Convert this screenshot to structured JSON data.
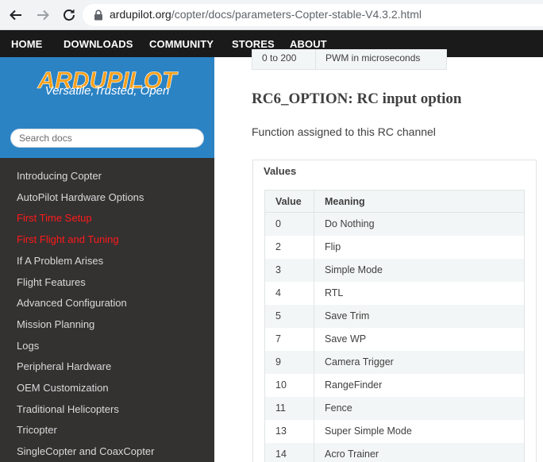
{
  "browser": {
    "url_host": "ardupilot.org",
    "url_path": "/copter/docs/parameters-Copter-stable-V4.3.2.html"
  },
  "topnav": [
    "HOME",
    "DOWNLOADS",
    "COMMUNITY",
    "STORES",
    "ABOUT"
  ],
  "brand": {
    "logo_text": "ARDUPILOT",
    "tagline": "Versatile,Trusted, Open",
    "search_placeholder": "Search docs"
  },
  "sidebar": {
    "items": [
      {
        "label": "Introducing Copter",
        "active": false
      },
      {
        "label": "AutoPilot Hardware Options",
        "active": false
      },
      {
        "label": "First Time Setup",
        "active": true
      },
      {
        "label": "First Flight and Tuning",
        "active": true
      },
      {
        "label": "If A Problem Arises",
        "active": false
      },
      {
        "label": "Flight Features",
        "active": false
      },
      {
        "label": "Advanced Configuration",
        "active": false
      },
      {
        "label": "Mission Planning",
        "active": false
      },
      {
        "label": "Logs",
        "active": false
      },
      {
        "label": "Peripheral Hardware",
        "active": false
      },
      {
        "label": "OEM Customization",
        "active": false
      },
      {
        "label": "Traditional Helicopters",
        "active": false
      },
      {
        "label": "Tricopter",
        "active": false
      },
      {
        "label": "SingleCopter and CoaxCopter",
        "active": false
      }
    ]
  },
  "prev_table": {
    "range": "0 to 200",
    "units": "PWM in microseconds"
  },
  "param": {
    "title": "RC6_OPTION: RC input option",
    "description": "Function assigned to this RC channel",
    "values_label": "Values",
    "headers": [
      "Value",
      "Meaning"
    ],
    "rows": [
      [
        "0",
        "Do Nothing"
      ],
      [
        "2",
        "Flip"
      ],
      [
        "3",
        "Simple Mode"
      ],
      [
        "4",
        "RTL"
      ],
      [
        "5",
        "Save Trim"
      ],
      [
        "7",
        "Save WP"
      ],
      [
        "9",
        "Camera Trigger"
      ],
      [
        "10",
        "RangeFinder"
      ],
      [
        "11",
        "Fence"
      ],
      [
        "13",
        "Super Simple Mode"
      ],
      [
        "14",
        "Acro Trainer"
      ]
    ]
  },
  "colors": {
    "brand_blue": "#2b83c4",
    "sidebar_dark": "#343131",
    "topnav_black": "#1a1a1a",
    "active_red": "#ff1a1a",
    "logo_orange": "#f6a01a"
  }
}
